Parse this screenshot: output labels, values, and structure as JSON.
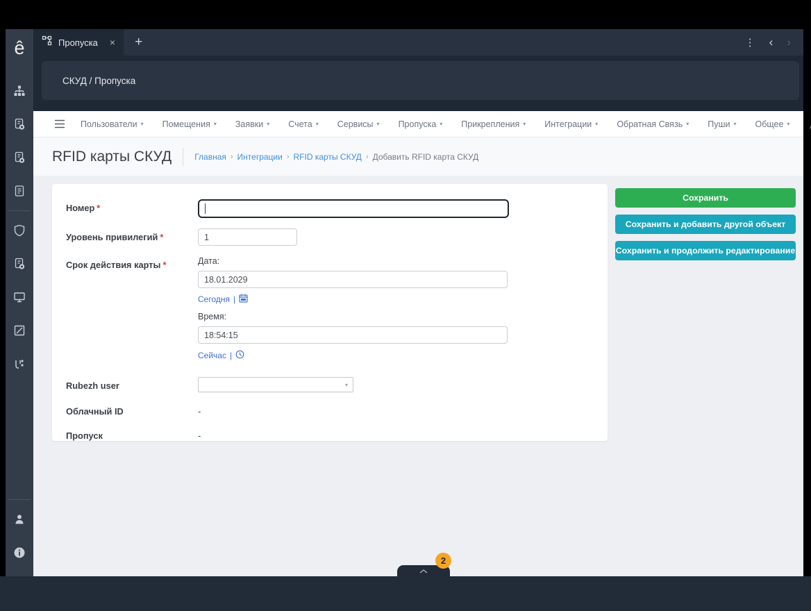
{
  "colors": {
    "accent_green": "#2eae53",
    "accent_teal": "#1aa6bc",
    "badge_orange": "#f5a423",
    "link_blue": "#4191d9",
    "action_link_blue": "#3e70d6"
  },
  "app": {
    "logo": "ê",
    "tab": {
      "title": "Пропуска",
      "close": "×",
      "new_tab": "+",
      "kebab": "⋮",
      "back": "‹",
      "forward": "›"
    },
    "header_breadcrumb": "СКУД / Пропуска"
  },
  "nav": {
    "caret": "▾",
    "items": [
      {
        "label": "Пользователи"
      },
      {
        "label": "Помещения"
      },
      {
        "label": "Заявки"
      },
      {
        "label": "Счета"
      },
      {
        "label": "Сервисы"
      },
      {
        "label": "Пропуска"
      },
      {
        "label": "Прикрепления"
      },
      {
        "label": "Интеграции"
      },
      {
        "label": "Обратная Связь"
      },
      {
        "label": "Пуши"
      },
      {
        "label": "Общее"
      }
    ]
  },
  "page": {
    "title": "RFID карты СКУД",
    "breadcrumb_separator": "›",
    "breadcrumbs": {
      "home": "Главная",
      "integrations": "Интеграции",
      "rfid": "RFID карты СКУД",
      "current": "Добавить RFID карта СКУД"
    }
  },
  "form": {
    "required_mark": "*",
    "number": {
      "label": "Номер",
      "value": ""
    },
    "privilege": {
      "label": "Уровень привилегий",
      "value": "1"
    },
    "validity": {
      "label": "Срок действия карты",
      "date_label": "Дата:",
      "date_value": "18.01.2029",
      "today_link": "Сегодня",
      "time_label": "Время:",
      "time_value": "18:54:15",
      "now_link": "Сейчас",
      "separator": "|"
    },
    "rubezh": {
      "label": "Rubezh user",
      "value": "",
      "caret": "▾"
    },
    "cloud_id": {
      "label": "Облачный ID",
      "value": "-"
    },
    "pass": {
      "label": "Пропуск",
      "value": "-"
    }
  },
  "actions": {
    "save": "Сохранить",
    "save_add": "Сохранить и добавить другой объект",
    "save_continue": "Сохранить и продолжить редактирование"
  },
  "footer": {
    "badge_count": "2"
  }
}
